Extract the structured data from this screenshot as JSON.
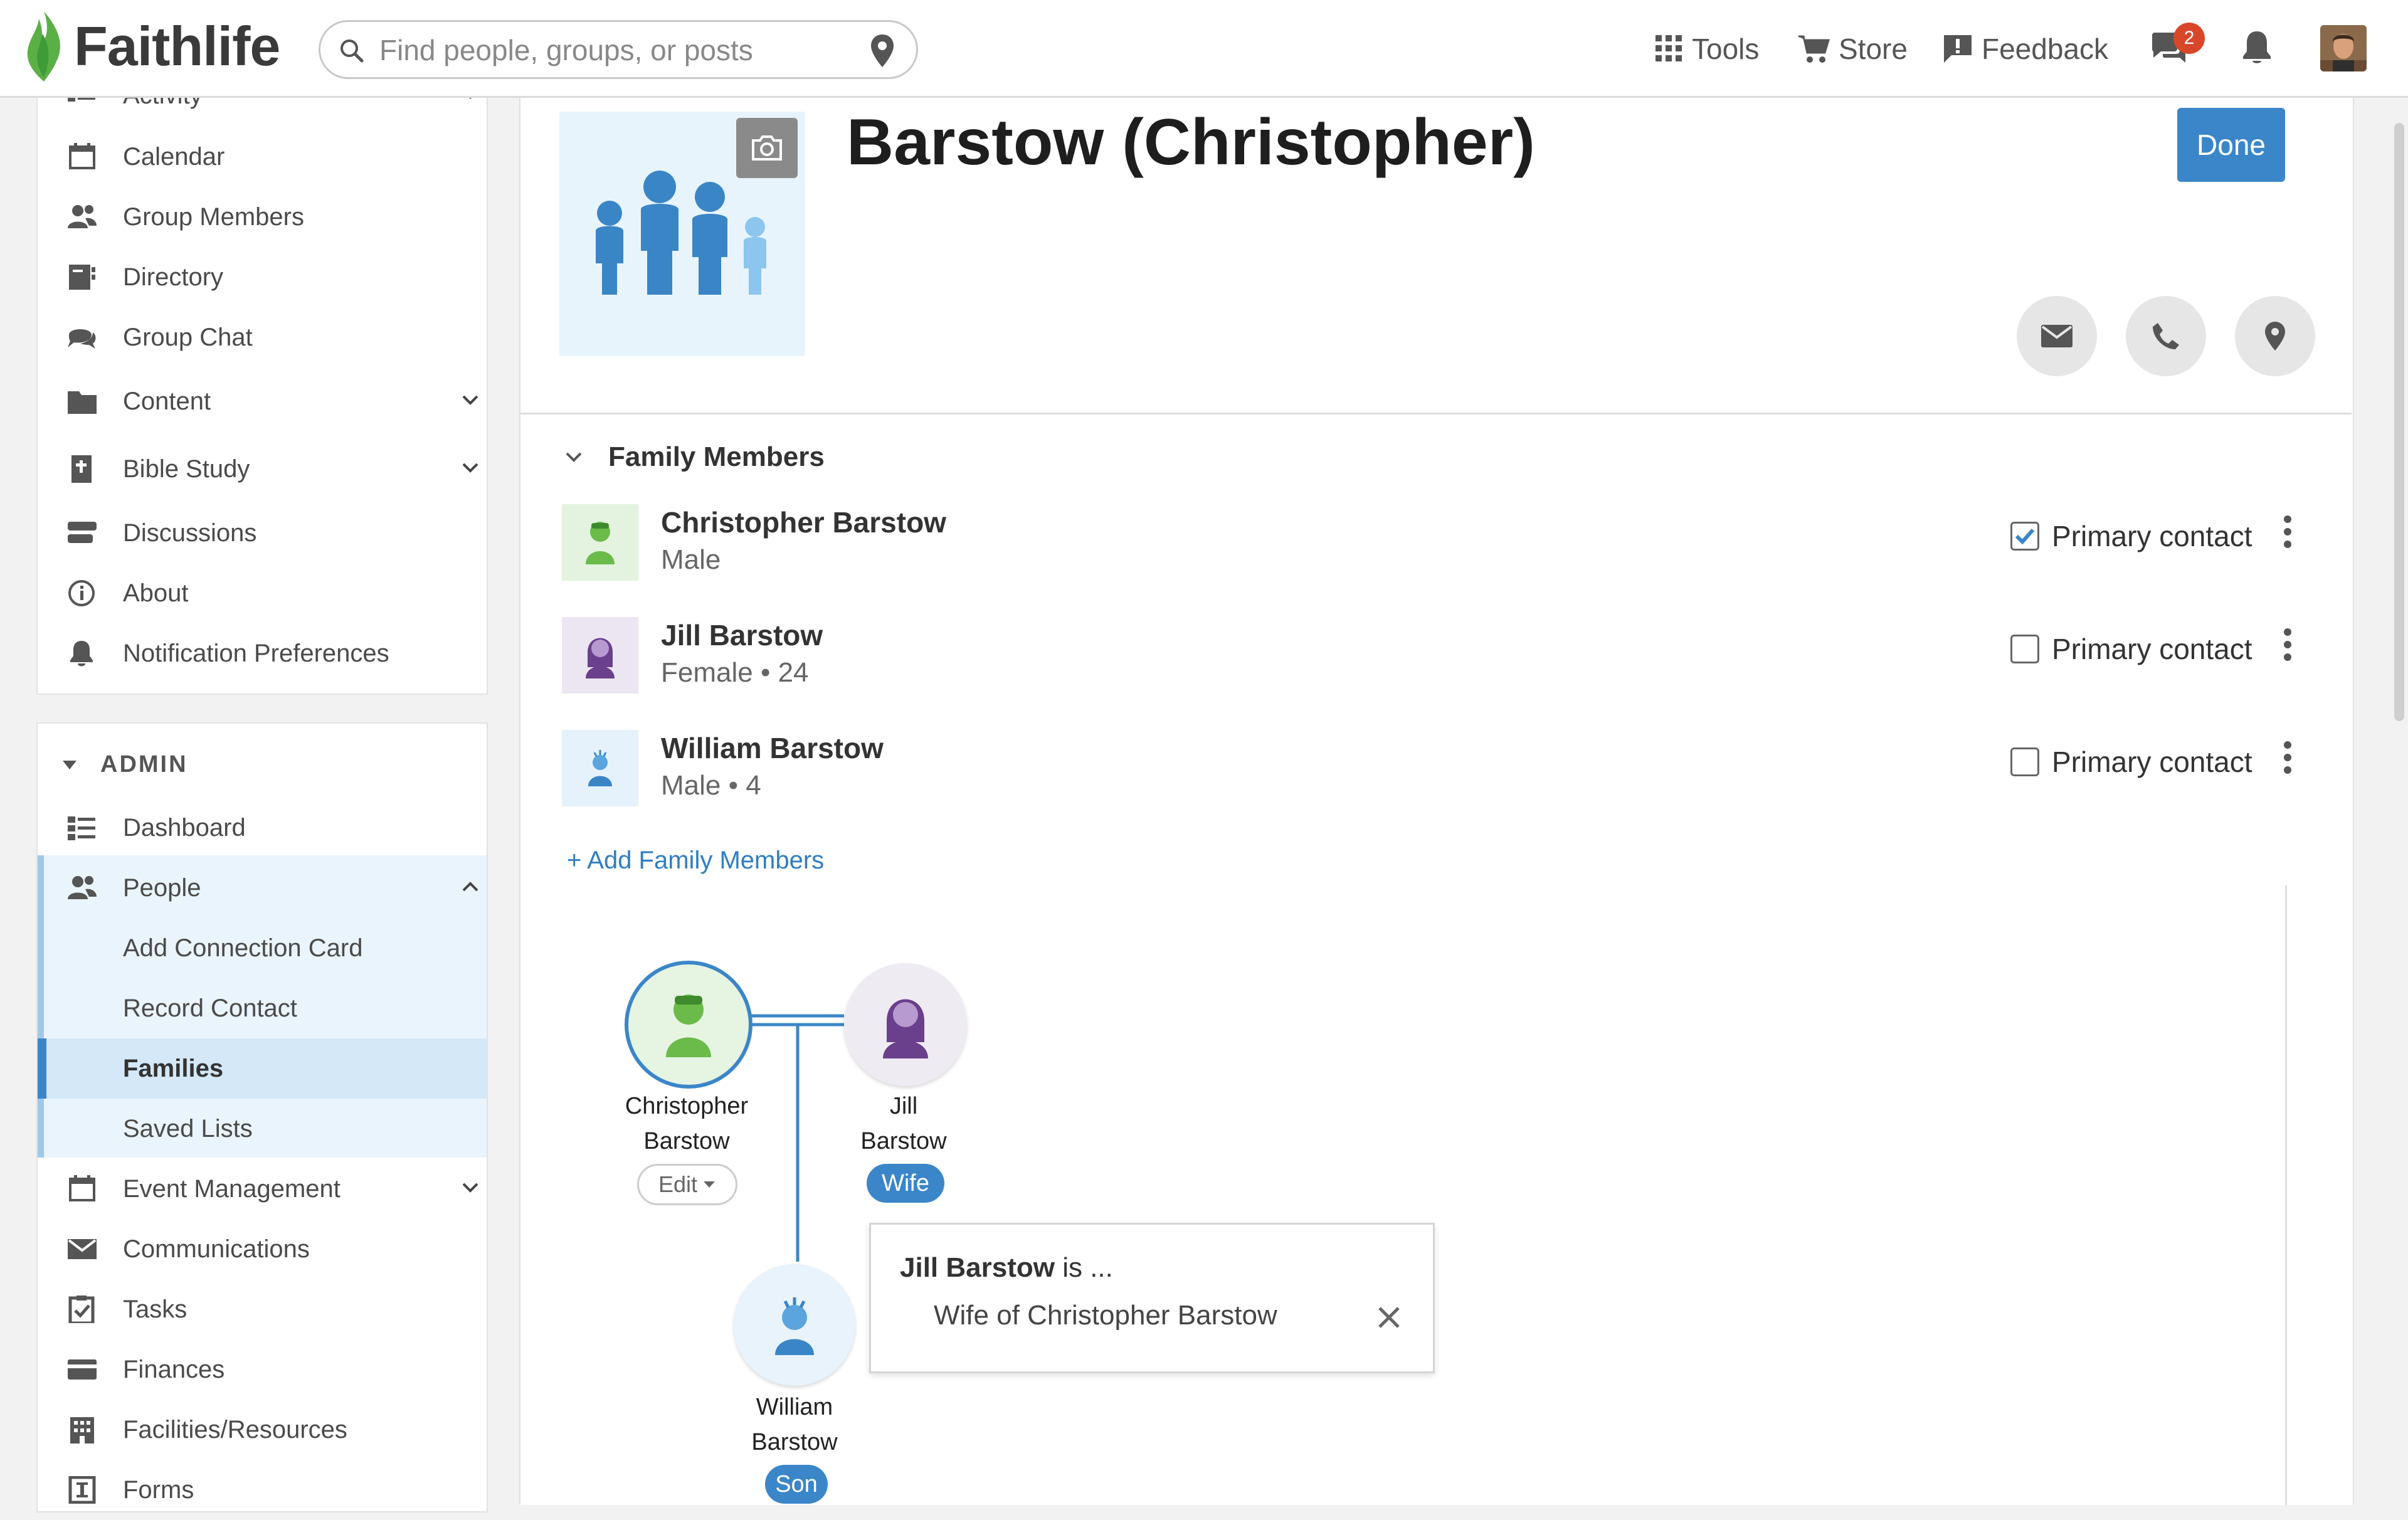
{
  "header": {
    "logo_text": "Faithlife",
    "search_placeholder": "Find people, groups, or posts",
    "nav": {
      "tools": "Tools",
      "store": "Store",
      "feedback": "Feedback"
    },
    "notification_count": "2"
  },
  "sidebar": {
    "items": [
      {
        "label": "Activity"
      },
      {
        "label": "Calendar"
      },
      {
        "label": "Group Members"
      },
      {
        "label": "Directory"
      },
      {
        "label": "Group Chat"
      },
      {
        "label": "Content"
      },
      {
        "label": "Bible Study"
      },
      {
        "label": "Discussions"
      },
      {
        "label": "About"
      },
      {
        "label": "Notification Preferences"
      }
    ],
    "admin_heading": "ADMIN",
    "admin_items": [
      {
        "label": "Dashboard"
      },
      {
        "label": "People"
      },
      {
        "label": "Add Connection Card"
      },
      {
        "label": "Record Contact"
      },
      {
        "label": "Families"
      },
      {
        "label": "Saved Lists"
      },
      {
        "label": "Event Management"
      },
      {
        "label": "Communications"
      },
      {
        "label": "Tasks"
      },
      {
        "label": "Finances"
      },
      {
        "label": "Facilities/Resources"
      },
      {
        "label": "Forms"
      }
    ]
  },
  "family": {
    "title": "Barstow (Christopher)",
    "done_label": "Done",
    "section_title": "Family Members",
    "primary_contact_label": "Primary contact",
    "members": [
      {
        "name": "Christopher Barstow",
        "detail": "Male",
        "primary": true
      },
      {
        "name": "Jill Barstow",
        "detail": "Female • 24",
        "primary": false
      },
      {
        "name": "William Barstow",
        "detail": "Male • 4",
        "primary": false
      }
    ],
    "add_label": "+ Add Family Members"
  },
  "tree": {
    "nodes": [
      {
        "first": "Christopher",
        "last": "Barstow"
      },
      {
        "first": "Jill",
        "last": "Barstow",
        "relation": "Wife"
      },
      {
        "first": "William",
        "last": "Barstow",
        "relation": "Son"
      }
    ],
    "edit_label": "Edit",
    "popup": {
      "subject": "Jill Barstow",
      "suffix": " is ...",
      "relation": "Wife of Christopher Barstow"
    }
  },
  "colors": {
    "accent": "#3b86c8",
    "brand_green": "#4caf50",
    "badge_red": "#d9472b"
  }
}
